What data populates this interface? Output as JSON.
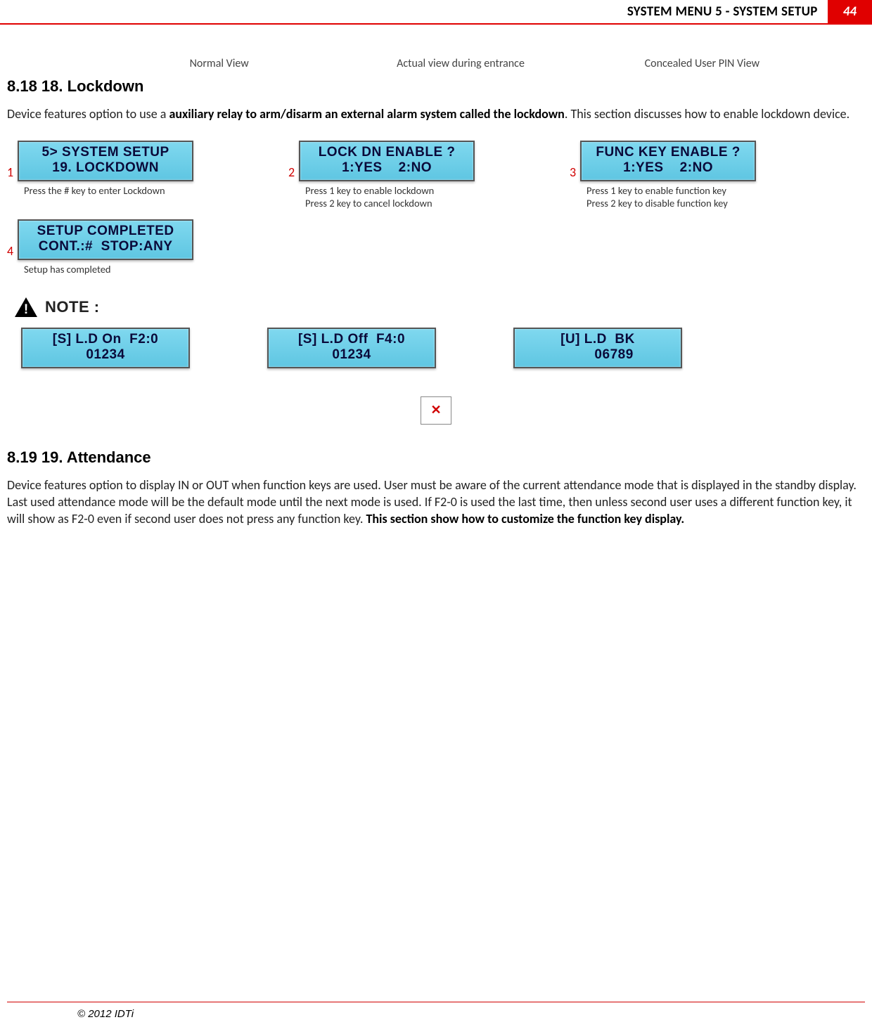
{
  "header": {
    "title": "SYSTEM MENU 5 - SYSTEM SETUP",
    "page_number": "44"
  },
  "view_labels": {
    "left": "Normal View",
    "center": "Actual view during entrance",
    "right": "Concealed User PIN View"
  },
  "section_818": {
    "heading": "8.18    18. Lockdown",
    "intro_pre": "Device features option to use a ",
    "intro_strong": "auxiliary relay to arm/disarm an external alarm system called the lockdown",
    "intro_post": ". This section discusses how to enable lockdown device."
  },
  "steps": [
    {
      "num": "1",
      "lcd": "5> SYSTEM SETUP\n19. LOCKDOWN",
      "caption": "Press the # key to enter Lockdown"
    },
    {
      "num": "2",
      "lcd": "LOCK DN ENABLE ?\n1:YES    2:NO",
      "caption": "Press 1 key to enable lockdown\nPress 2 key to cancel lockdown"
    },
    {
      "num": "3",
      "lcd": "FUNC KEY ENABLE ?\n1:YES    2:NO",
      "caption": "Press 1 key to enable function key\nPress 2 key to disable function key"
    },
    {
      "num": "4",
      "lcd": "SETUP COMPLETED\nCONT.:#  STOP:ANY",
      "caption": "Setup has completed"
    }
  ],
  "note_label": "NOTE :",
  "note_lcds": [
    "[S] L.D On  F2:0\n01234",
    "[S] L.D Off  F4:0\n01234",
    "[U] L.D  BK\n        06789"
  ],
  "section_819": {
    "heading": "8.19    19. Attendance",
    "body_pre": "Device features option to display IN or OUT when function keys are used. User must be aware of the current attendance mode that is displayed in the standby display. Last used attendance mode will be the default mode until the next mode is used. If F2-0 is used the last time, then unless second user uses a different function key, it will show as F2-0 even if second user does not press any function key. ",
    "body_strong": "This section show how to customize the function key display."
  },
  "footer": "© 2012 IDTi"
}
